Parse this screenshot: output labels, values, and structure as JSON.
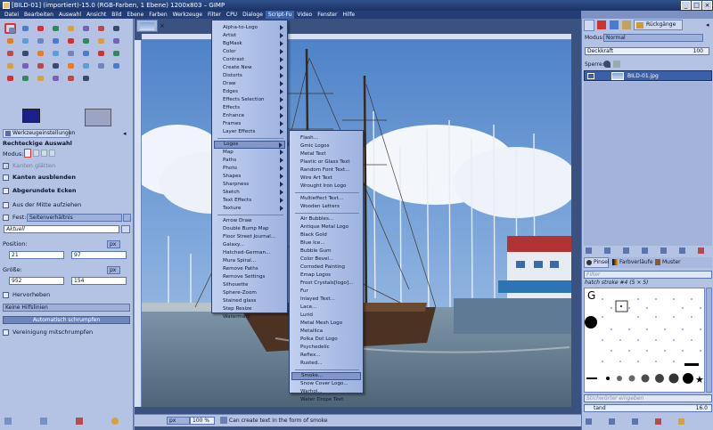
{
  "window": {
    "title": "[BILD-01] (importiert)-15.0 (RGB-Farben, 1 Ebene) 1200x803 – GIMP",
    "controls": [
      "_",
      "□",
      "×"
    ]
  },
  "menubar": [
    "Datei",
    "Bearbeiten",
    "Auswahl",
    "Ansicht",
    "Bild",
    "Ebene",
    "Farben",
    "Werkzeuge",
    "Filter",
    "CPU",
    "Dialoge",
    "Script-Fu",
    "Video",
    "Fenster",
    "Hilfe"
  ],
  "menubar_open": "Script-Fu",
  "toolbox": {
    "tab_label": "Werkzeugeinstellungen",
    "section_title": "Rechteckige Auswahl",
    "mode_label": "Modus:",
    "options": [
      {
        "label": "Kanten glätten",
        "checked": true,
        "disabled": true
      },
      {
        "label": "Kanten ausblenden",
        "checked": false,
        "bold": true
      },
      {
        "label": "Abgerundete Ecken",
        "checked": false,
        "bold": true
      },
      {
        "label": "Aus der Mitte aufziehen",
        "checked": false
      }
    ],
    "fixed_label": "Fest:",
    "fixed_value": "Seitenverhältnis",
    "current_value": "Aktuell",
    "position_label": "Position:",
    "position_unit": "px",
    "position_x": "21",
    "position_y": "97",
    "size_label": "Größe:",
    "size_unit": "px",
    "size_w": "952",
    "size_h": "154",
    "highlight_label": "Hervorheben",
    "guides_value": "Keine Hilfslinien",
    "shrink_button": "Automatisch schrumpfen",
    "merged_label": "Vereinigung mitschrumpfen"
  },
  "statusbar": {
    "unit": "px",
    "zoom": "100 %",
    "message": "Can create text in the form of smoke"
  },
  "rightpanel": {
    "undo_tab": "Rückgänge",
    "mode_label": "Modus:",
    "mode_value": "Normal",
    "opacity_label": "Deckkraft",
    "opacity_value": "100",
    "lock_label": "Sperre:",
    "layer_name": "BILD-01.jpg",
    "brush_tab": "Pinsel",
    "gradient_tab": "Farbverläufe",
    "pattern_tab": "Muster",
    "filter_placeholder": "Filter",
    "brush_name": "hatch stroke #4 (5 × 5)",
    "tags_placeholder": "Stichwörter eingeben",
    "brush_footer": "tand",
    "spacing_value": "16.0"
  },
  "menus": {
    "scriptfu": [
      {
        "label": "Alpha-to-Logo",
        "sub": true
      },
      {
        "label": "Artist",
        "sub": true
      },
      {
        "label": "BgMask",
        "sub": true
      },
      {
        "label": "Color",
        "sub": true
      },
      {
        "label": "Contrast",
        "sub": true
      },
      {
        "label": "Create New",
        "sub": true
      },
      {
        "label": "Distorts",
        "sub": true
      },
      {
        "label": "Draw",
        "sub": true
      },
      {
        "label": "Edges",
        "sub": true
      },
      {
        "label": "Effects Selection",
        "sub": true
      },
      {
        "label": "Effects",
        "sub": true
      },
      {
        "label": "Enhance",
        "sub": true
      },
      {
        "label": "Frames",
        "sub": true
      },
      {
        "label": "Layer Effects",
        "sub": true
      },
      {
        "label": "Logos",
        "sub": true,
        "selected": true
      },
      {
        "label": "Map",
        "sub": true
      },
      {
        "label": "Paths",
        "sub": true
      },
      {
        "label": "Photo",
        "sub": true
      },
      {
        "label": "Shapes",
        "sub": true
      },
      {
        "label": "Sharpness",
        "sub": true
      },
      {
        "label": "Sketch",
        "sub": true
      },
      {
        "label": "Text Effects",
        "sub": true
      },
      {
        "label": "Texture",
        "sub": true
      },
      {
        "label": "Arrow Draw"
      },
      {
        "label": "Double Bump Map"
      },
      {
        "label": "Floor Street Journal..."
      },
      {
        "label": "Galaxy..."
      },
      {
        "label": "Hatched-German..."
      },
      {
        "label": "Mura Spiral..."
      },
      {
        "label": "Remove Paths"
      },
      {
        "label": "Remove Settings"
      },
      {
        "label": "Silhouette"
      },
      {
        "label": "Sphere-Zoom"
      },
      {
        "label": "Stained glass"
      },
      {
        "label": "Step Resize"
      },
      {
        "label": "Watermark"
      }
    ],
    "logos": [
      {
        "label": "Flash..."
      },
      {
        "label": "Gmic Logos"
      },
      {
        "label": "Metal Text"
      },
      {
        "label": "Plastic or Glass Text"
      },
      {
        "label": "Random Font Text..."
      },
      {
        "label": "Wire Art Text"
      },
      {
        "label": "Wrought Iron Logo"
      },
      {
        "label": "Multieffect Text..."
      },
      {
        "label": "Wooden Letters"
      },
      {
        "label": "Air Bubbles..."
      },
      {
        "label": "Antique Metal Logo"
      },
      {
        "label": "Black Gold"
      },
      {
        "label": "Blue Ice..."
      },
      {
        "label": "Bubble Gum"
      },
      {
        "label": "Color Bevel..."
      },
      {
        "label": "Corroded Painting"
      },
      {
        "label": "Emap Logos"
      },
      {
        "label": "Frost Crystals[logo]..."
      },
      {
        "label": "Fur"
      },
      {
        "label": "Inlayed Text..."
      },
      {
        "label": "Lace..."
      },
      {
        "label": "Lurid"
      },
      {
        "label": "Metal Mesh Logo"
      },
      {
        "label": "Metallica"
      },
      {
        "label": "Polka Dot Logo"
      },
      {
        "label": "Psychedelic"
      },
      {
        "label": "Reflex..."
      },
      {
        "label": "Rusted..."
      },
      {
        "label": "Smoke...",
        "selected": true
      },
      {
        "label": "Snow Cover Logo..."
      },
      {
        "label": "Warhol..."
      },
      {
        "label": "Water Drope Text"
      }
    ]
  },
  "colors": {
    "titlebar": "#1c3366",
    "accent": "#3d63a8",
    "menu_bg": "#b4c2e3"
  }
}
